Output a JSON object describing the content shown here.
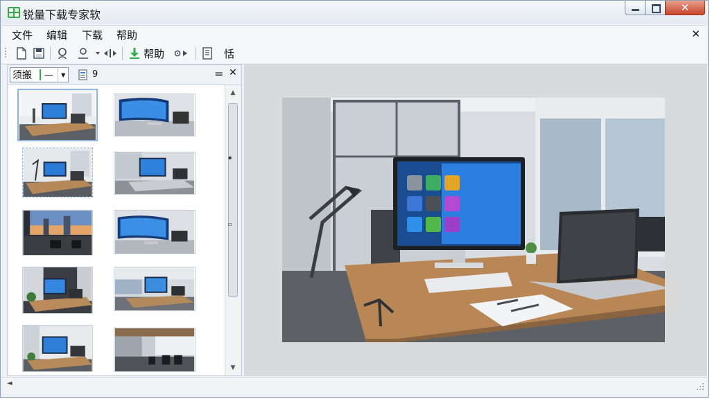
{
  "window": {
    "title": "锐量下载专家软"
  },
  "titlebar": {
    "minimize_icon": "minimize-icon",
    "maximize_icon": "maximize-icon",
    "close_glyph": "✕"
  },
  "menu": {
    "items": [
      "文件",
      "编辑",
      "下载",
      "帮助"
    ],
    "close_glyph": "✕"
  },
  "toolbar": {
    "help_label": "帮助",
    "extra_label": "恬"
  },
  "left_panel": {
    "combo_label": "须搬",
    "combo_value": "—",
    "page_count": "9",
    "pin_glyph": "=",
    "close_glyph": "✕",
    "scroll_up": "▲",
    "scroll_down": "▼",
    "scroll_mark_1": "▪",
    "scroll_mark_2": "▫",
    "thumbnails": [
      {
        "row": 0,
        "col": 0,
        "scene": "desk-monitor-laptop",
        "selected": true
      },
      {
        "row": 0,
        "col": 1,
        "scene": "curved-monitor"
      },
      {
        "row": 1,
        "col": 0,
        "scene": "desk-monitor-laptop-lamp",
        "selected2": true
      },
      {
        "row": 1,
        "col": 1,
        "scene": "office-monitor-laptop"
      },
      {
        "row": 2,
        "col": 0,
        "scene": "city-office-sunset"
      },
      {
        "row": 2,
        "col": 1,
        "scene": "curved-monitor-laptop"
      },
      {
        "row": 3,
        "col": 0,
        "scene": "plant-desk-monitor"
      },
      {
        "row": 3,
        "col": 1,
        "scene": "office-window-desk"
      },
      {
        "row": 4,
        "col": 0,
        "scene": "desk-monitor-plant"
      },
      {
        "row": 4,
        "col": 1,
        "scene": "office-hall-chairs"
      }
    ]
  },
  "preview": {
    "scene": "office-desk-monitor-laptop",
    "icons": [
      "gallery",
      "chat",
      "settings",
      "photo",
      "media",
      "color",
      "bird",
      "message",
      "app"
    ]
  },
  "statusbar": {
    "scroll_left": "◄"
  },
  "colors": {
    "accent": "#2fae48",
    "close_red": "#c9452a",
    "panel_bg": "#d9dadb"
  }
}
